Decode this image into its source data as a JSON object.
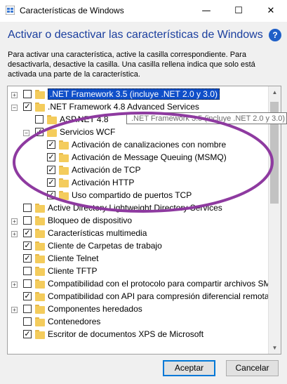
{
  "window": {
    "title": "Características de Windows",
    "minimize": "—",
    "maximize": "☐",
    "close": "✕"
  },
  "heading": "Activar o desactivar las características de Windows",
  "help": "?",
  "description": "Para activar una característica, active la casilla correspondiente. Para desactivarla, desactive la casilla. Una casilla rellena indica que solo está activada una parte de la característica.",
  "tree": {
    "items": [
      {
        "label": ".NET Framework 3.5 (incluye .NET 2.0 y 3.0)",
        "expander": "+",
        "check": "",
        "selected": true
      },
      {
        "label": ".NET Framework 4.8 Advanced Services",
        "expander": "−",
        "check": "✓"
      },
      {
        "label": "ASP.NET 4.8",
        "expander": "",
        "check": ""
      },
      {
        "label": "Servicios WCF",
        "expander": "−",
        "check": "✓"
      },
      {
        "label": "Activación de canalizaciones con nombre",
        "expander": "",
        "check": "✓"
      },
      {
        "label": "Activación de Message Queuing (MSMQ)",
        "expander": "",
        "check": "✓"
      },
      {
        "label": "Activación de TCP",
        "expander": "",
        "check": "✓"
      },
      {
        "label": "Activación HTTP",
        "expander": "",
        "check": "✓"
      },
      {
        "label": "Uso compartido de puertos TCP",
        "expander": "",
        "check": "✓"
      },
      {
        "label": "Active Directory Lightweight Directory Services",
        "expander": "",
        "check": ""
      },
      {
        "label": "Bloqueo de dispositivo",
        "expander": "+",
        "check": ""
      },
      {
        "label": "Características multimedia",
        "expander": "+",
        "check": "✓"
      },
      {
        "label": "Cliente de Carpetas de trabajo",
        "expander": "",
        "check": "✓"
      },
      {
        "label": "Cliente Telnet",
        "expander": "",
        "check": "✓"
      },
      {
        "label": "Cliente TFTP",
        "expander": "",
        "check": ""
      },
      {
        "label": "Compatibilidad con el protocolo para compartir archivos SM",
        "expander": "+",
        "check": ""
      },
      {
        "label": "Compatibilidad con API para compresión diferencial remota",
        "expander": "",
        "check": "✓"
      },
      {
        "label": "Componentes heredados",
        "expander": "+",
        "check": ""
      },
      {
        "label": "Contenedores",
        "expander": "",
        "check": ""
      },
      {
        "label": "Escritor de documentos XPS de Microsoft",
        "expander": "",
        "check": "✓"
      }
    ]
  },
  "tooltip": ".NET Framework 3.5 (incluye .NET 2.0 y 3.0)",
  "scrollbar": {
    "up": "▲",
    "down": "▼"
  },
  "buttons": {
    "accept": "Aceptar",
    "cancel": "Cancelar"
  },
  "colors": {
    "heading": "#1a3e9e",
    "selection": "#0f4fc9",
    "annotation": "#8e3aa0",
    "folder": "#f4cc5c"
  }
}
